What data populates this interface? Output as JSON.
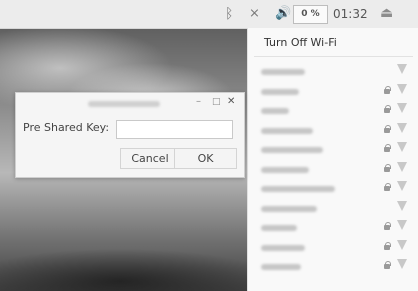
{
  "panel": {
    "cpu": "0 %",
    "clock": "01:32",
    "icons": [
      "bluetooth-icon",
      "wifi-disconnected-icon",
      "volume-icon",
      "eject-icon"
    ]
  },
  "wifi_menu": {
    "turn_off_label": "Turn Off Wi-Fi",
    "networks_secured": [
      false,
      true,
      true,
      true,
      true,
      true,
      true,
      false,
      true,
      true,
      true,
      true
    ]
  },
  "dialog": {
    "psk_label": "Pre Shared Key:",
    "psk_value": "",
    "cancel_label": "Cancel",
    "ok_label": "OK"
  }
}
